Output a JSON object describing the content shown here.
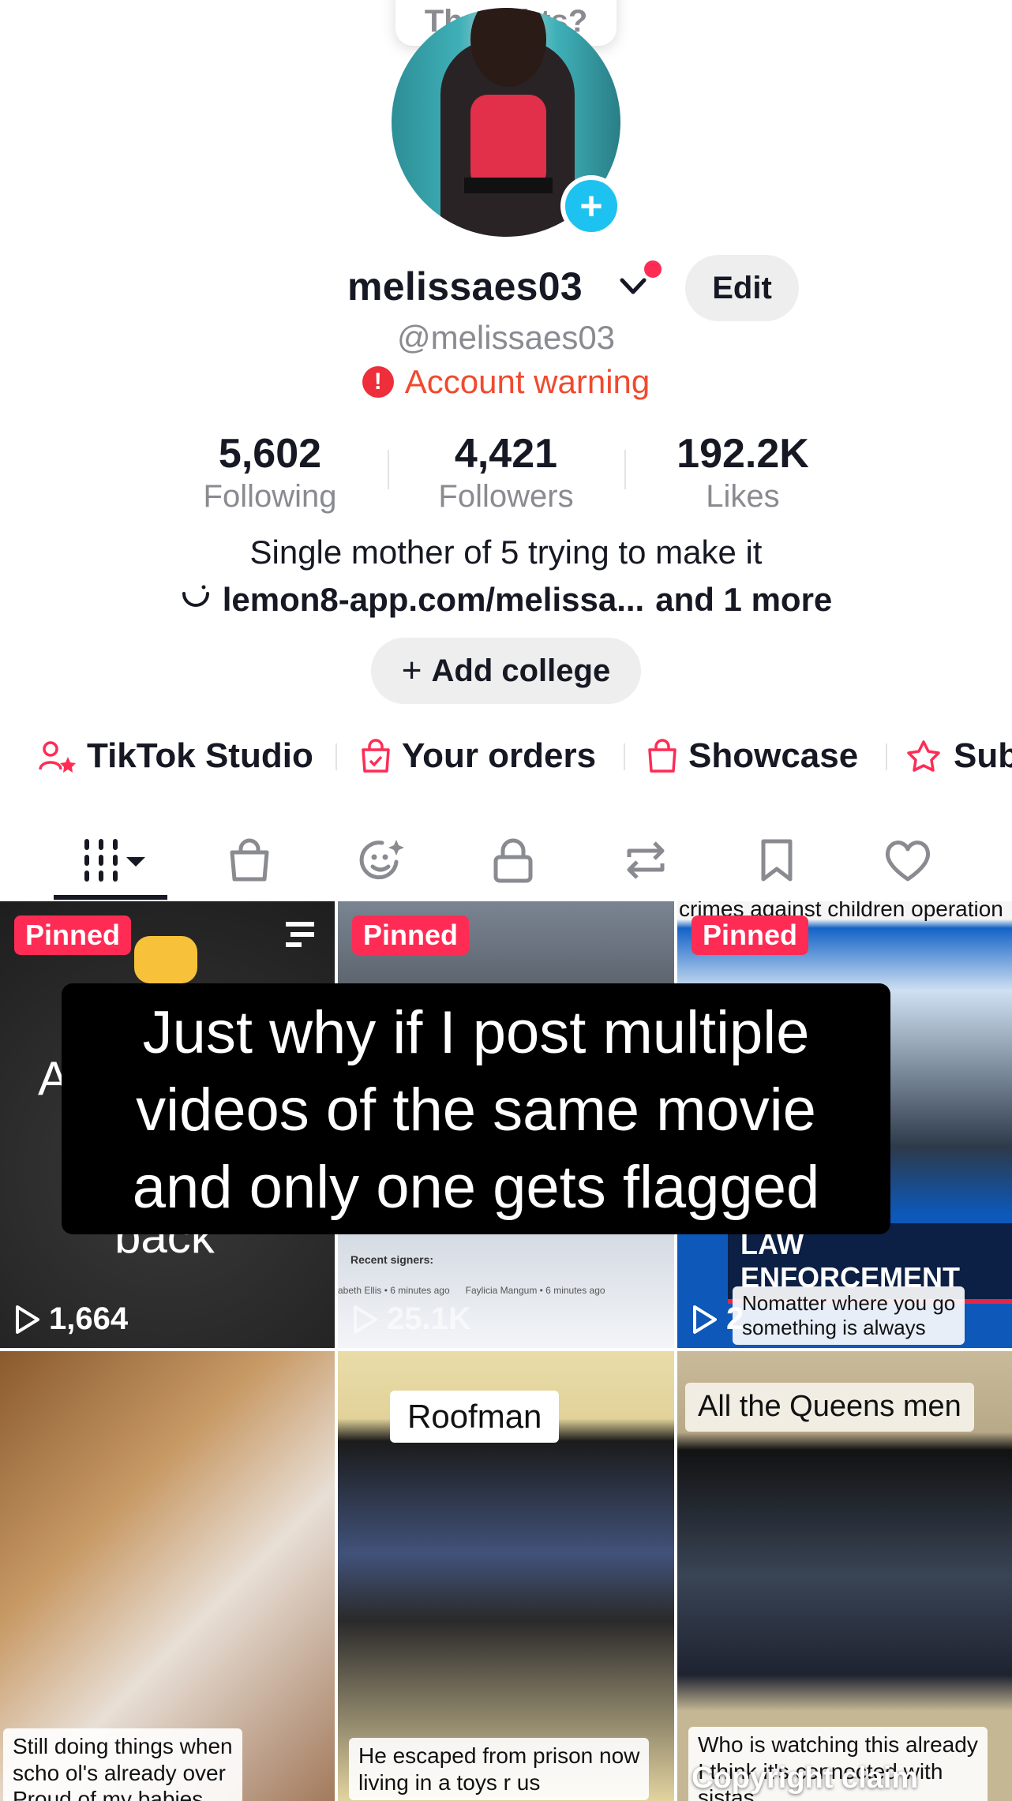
{
  "profile": {
    "thought_bubble": "Thoughts?",
    "username": "melissaes03",
    "handle": "@melissaes03",
    "edit_label": "Edit",
    "account_warning": "Account warning",
    "stats": [
      {
        "value": "5,602",
        "label": "Following"
      },
      {
        "value": "4,421",
        "label": "Followers"
      },
      {
        "value": "192.2K",
        "label": "Likes"
      }
    ],
    "bio": "Single mother of 5 trying to make it",
    "link_text": "lemon8-app.com/melissa...",
    "link_more": "and 1 more",
    "add_college": "Add college"
  },
  "quick_links": [
    {
      "label": "TikTok Studio",
      "icon": "studio-icon"
    },
    {
      "label": "Your orders",
      "icon": "orders-icon"
    },
    {
      "label": "Showcase",
      "icon": "showcase-icon"
    },
    {
      "label": "Sub",
      "icon": "subscription-icon"
    }
  ],
  "tabs": [
    {
      "icon": "videos-grid-icon"
    },
    {
      "icon": "shop-bag-icon"
    },
    {
      "icon": "stickers-icon"
    },
    {
      "icon": "private-lock-icon"
    },
    {
      "icon": "reposts-icon"
    },
    {
      "icon": "favorites-bookmark-icon"
    },
    {
      "icon": "liked-heart-icon"
    }
  ],
  "videos": [
    {
      "pinned": "Pinned",
      "views": "1,664",
      "text_a": "A",
      "text_b": "back"
    },
    {
      "pinned": "Pinned",
      "views": "25.1K",
      "caption": "Recent signers:",
      "signers": "abeth Ellis • 6 minutes ago      Faylicia Mangum • 6 minutes ago"
    },
    {
      "pinned": "Pinned",
      "views": "2",
      "header": "crimes against children operation",
      "banner": "LAW ENFORCEMENT",
      "caption": "Nomatter where you go\nsomething is always"
    },
    {
      "caption": "Still doing things when\nscho ol's already over\nProud of my babies"
    },
    {
      "title": "Roofman",
      "caption": "He escaped from prison now\nliving in a toys r us"
    },
    {
      "title": "All the Queens men",
      "caption": "Who is watching this already\nI think it's connected with\nsistas",
      "claim": "Copyright claim"
    }
  ],
  "overlay_text": [
    "Just why if I post multiple",
    "videos of the same movie",
    "and only one gets flagged"
  ],
  "colors": {
    "accent": "#fe2c55",
    "warning": "#f04a2f",
    "plus": "#1ec2f0"
  }
}
